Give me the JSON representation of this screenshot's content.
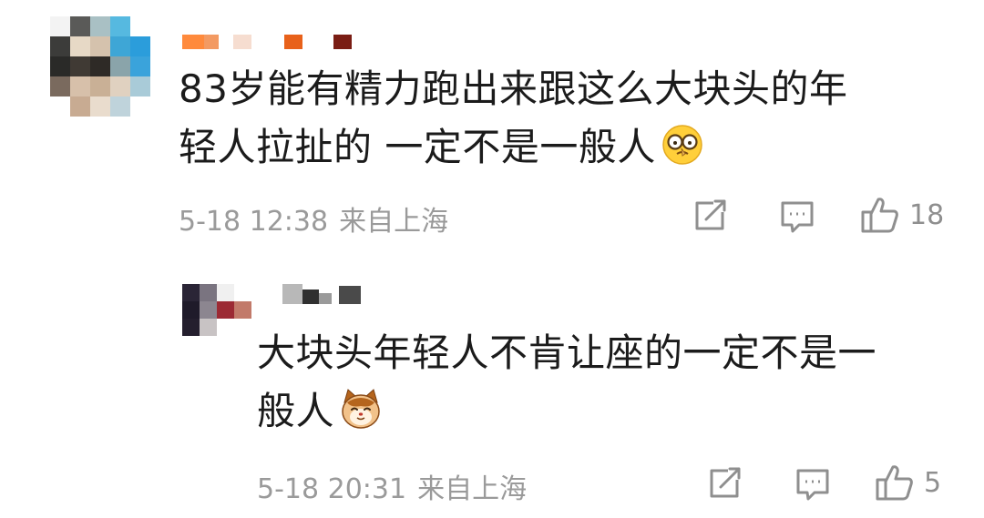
{
  "comment": {
    "text_lines": [
      "83岁能有精力跑出来跟这么大块头的年",
      "轻人拉扯的 一定不是一般人"
    ],
    "emoji": "face-with-glasses-emoji",
    "time": "5-18 12:38",
    "location": "来自上海",
    "likes": "18",
    "reply": {
      "text_lines": [
        "大块头年轻人不肯让座的一定不是一",
        "般人"
      ],
      "emoji": "cat-face-emoji",
      "time": "5-18 20:31",
      "location": "来自上海",
      "likes": "5"
    }
  },
  "icons": {
    "share": "share-icon",
    "comment": "comment-icon",
    "like": "thumbs-up-icon"
  },
  "colors": {
    "text": "#1b1b1b",
    "meta": "#9a9a9a",
    "icon": "#8f8f8f"
  }
}
